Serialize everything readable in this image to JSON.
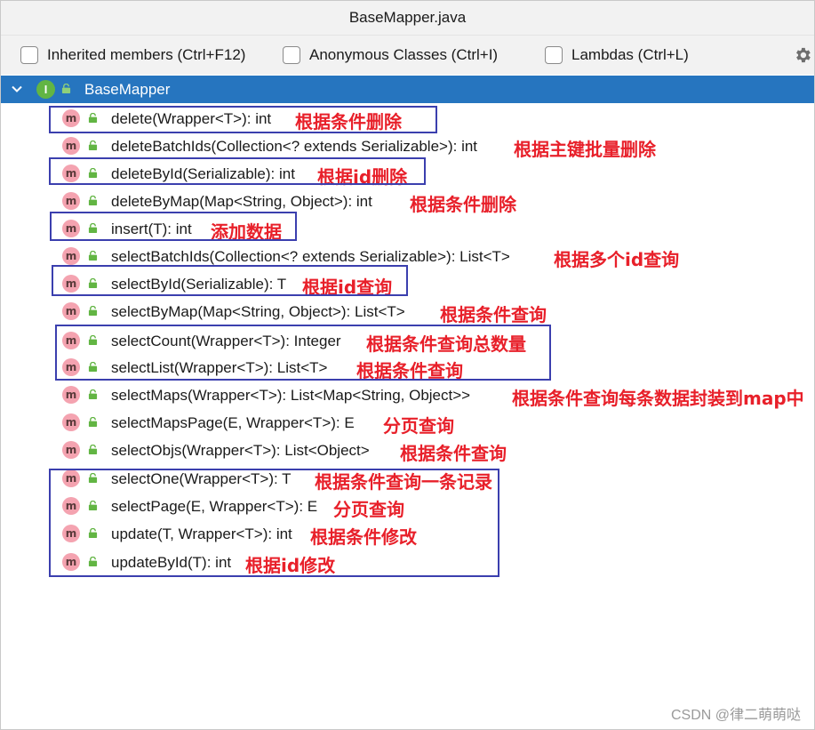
{
  "window": {
    "title": "BaseMapper.java"
  },
  "toolbar": {
    "options": [
      {
        "label": "Inherited members (Ctrl+F12)"
      },
      {
        "label": "Anonymous Classes (Ctrl+I)"
      },
      {
        "label": "Lambdas (Ctrl+L)"
      }
    ],
    "settings_icon": "gear-icon"
  },
  "tree": {
    "root": {
      "label": "BaseMapper",
      "icon_letter": "I"
    },
    "method_icon_letter": "m",
    "methods": [
      {
        "signature": "delete(Wrapper<T>): int",
        "note": "根据条件删除"
      },
      {
        "signature": "deleteBatchIds(Collection<? extends Serializable>): int",
        "note": "根据主键批量删除"
      },
      {
        "signature": "deleteById(Serializable): int",
        "note": "根据id删除"
      },
      {
        "signature": "deleteByMap(Map<String, Object>): int",
        "note": "根据条件删除"
      },
      {
        "signature": "insert(T): int",
        "note": "添加数据"
      },
      {
        "signature": "selectBatchIds(Collection<? extends Serializable>): List<T>",
        "note": "根据多个id查询"
      },
      {
        "signature": "selectById(Serializable): T",
        "note": "根据id查询"
      },
      {
        "signature": "selectByMap(Map<String, Object>): List<T>",
        "note": "根据条件查询"
      },
      {
        "signature": "selectCount(Wrapper<T>): Integer",
        "note": "根据条件查询总数量"
      },
      {
        "signature": "selectList(Wrapper<T>): List<T>",
        "note": "根据条件查询"
      },
      {
        "signature": "selectMaps(Wrapper<T>): List<Map<String, Object>>",
        "note": "根据条件查询每条数据封装到map中"
      },
      {
        "signature": "selectMapsPage(E, Wrapper<T>): E",
        "note": "分页查询"
      },
      {
        "signature": "selectObjs(Wrapper<T>): List<Object>",
        "note": "根据条件查询"
      },
      {
        "signature": "selectOne(Wrapper<T>): T",
        "note": "根据条件查询一条记录"
      },
      {
        "signature": "selectPage(E, Wrapper<T>): E",
        "note": "分页查询"
      },
      {
        "signature": "update(T, Wrapper<T>): int",
        "note": "根据条件修改"
      },
      {
        "signature": "updateById(T): int",
        "note": "根据id修改"
      }
    ]
  },
  "watermark": "CSDN @律二萌萌哒",
  "colors": {
    "selection": "#2675bf",
    "annotation": "#e8202a",
    "highlight_box": "#3b3fae",
    "method_icon": "#f4a3b0",
    "interface_icon": "#62b543",
    "lock_icon": "#62b543"
  }
}
